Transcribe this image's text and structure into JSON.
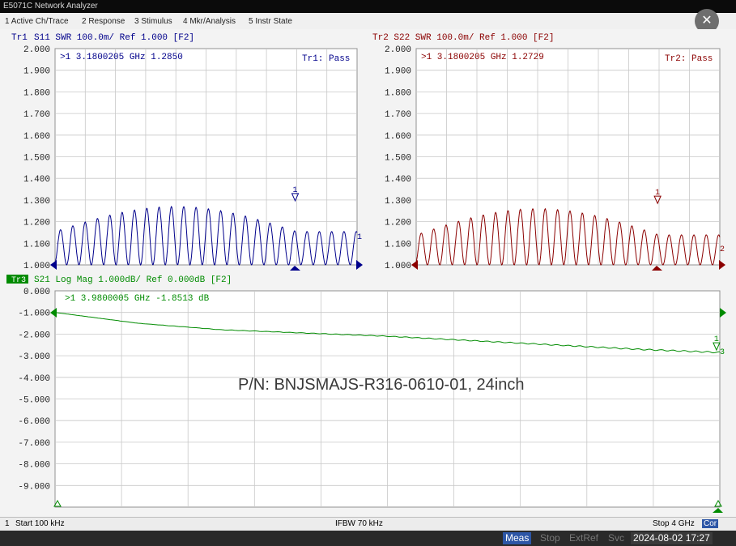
{
  "window": {
    "title": "E5071C Network Analyzer"
  },
  "menu": [
    "1 Active Ch/Trace",
    "2 Response",
    "3 Stimulus",
    "4 Mkr/Analysis",
    "5 Instr State"
  ],
  "colors": {
    "tr1": "#00008b",
    "tr2": "#8b0000",
    "tr3": "#008b00",
    "grid": "#c8c8c8",
    "frame": "#909090"
  },
  "tr1": {
    "header_prefix": "Tr1",
    "header": "S11  SWR 100.0m/ Ref 1.000 [F2]",
    "marker_label": ">1  3.1800205 GHz  1.2850",
    "pass_label": "Tr1: Pass",
    "y_ticks": [
      "2.000",
      "1.900",
      "1.800",
      "1.700",
      "1.600",
      "1.500",
      "1.400",
      "1.300",
      "1.200",
      "1.100",
      "1.000"
    ],
    "marker_index": "1",
    "end_label": "1"
  },
  "tr2": {
    "header": "Tr2 S22  SWR 100.0m/ Ref 1.000 [F2]",
    "marker_label": ">1  3.1800205 GHz  1.2729",
    "pass_label": "Tr2: Pass",
    "y_ticks": [
      "2.000",
      "1.900",
      "1.800",
      "1.700",
      "1.600",
      "1.500",
      "1.400",
      "1.300",
      "1.200",
      "1.100",
      "1.000"
    ],
    "marker_index": "1",
    "end_label": "2"
  },
  "tr3": {
    "header_prefix": "Tr3",
    "header": "S21 Log Mag 1.000dB/ Ref 0.000dB [F2]",
    "marker_label": ">1  3.9800005 GHz -1.8513 dB",
    "y_ticks": [
      "0.000",
      "-1.000",
      "-2.000",
      "-3.000",
      "-4.000",
      "-5.000",
      "-6.000",
      "-7.000",
      "-8.000",
      "-9.000"
    ],
    "marker_index": "1",
    "end_label": "3",
    "annotation": "P/N: BNJSMAJS-R316-0610-01, 24inch"
  },
  "chart_data": [
    {
      "type": "line",
      "title": "Tr1 S11 SWR",
      "x_range_ghz": [
        0.0001,
        4
      ],
      "ylim": [
        1.0,
        2.0
      ],
      "series": [
        {
          "name": "S11",
          "marker": {
            "x": 3.1800205,
            "y": 1.285
          },
          "approx_ripple_envelope": [
            1.07,
            1.28
          ]
        }
      ]
    },
    {
      "type": "line",
      "title": "Tr2 S22 SWR",
      "x_range_ghz": [
        0.0001,
        4
      ],
      "ylim": [
        1.0,
        2.0
      ],
      "series": [
        {
          "name": "S22",
          "marker": {
            "x": 3.1800205,
            "y": 1.2729
          },
          "approx_ripple_envelope": [
            1.05,
            1.27
          ]
        }
      ]
    },
    {
      "type": "line",
      "title": "Tr3 S21 Log Mag",
      "x_range_ghz": [
        0.0001,
        4
      ],
      "ylim": [
        -9.0,
        1.0
      ],
      "series": [
        {
          "name": "S21",
          "marker": {
            "x": 3.9800005,
            "y": -1.8513
          },
          "x": [
            0.0001,
            0.5,
            1.0,
            1.5,
            2.0,
            2.5,
            3.0,
            3.5,
            4.0
          ],
          "y": [
            0.0,
            -0.5,
            -0.8,
            -0.95,
            -1.1,
            -1.3,
            -1.5,
            -1.7,
            -1.85
          ]
        }
      ]
    }
  ],
  "status": {
    "channel": "1",
    "start": "Start 100 kHz",
    "ifbw": "IFBW 70 kHz",
    "stop": "Stop 4 GHz",
    "cor": "Cor"
  },
  "taskbar": {
    "meas": "Meas",
    "stop": "Stop",
    "extref": "ExtRef",
    "svc": "Svc",
    "datetime": "2024-08-02 17:27"
  }
}
